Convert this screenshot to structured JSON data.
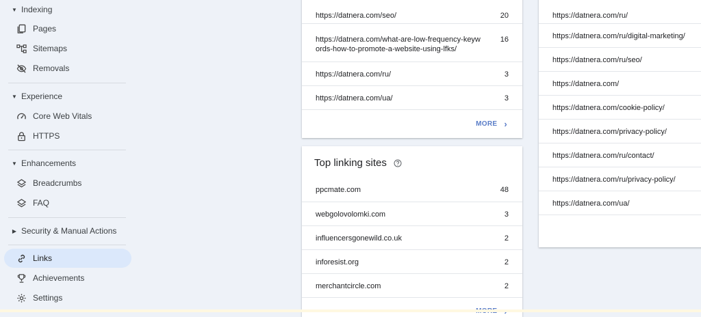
{
  "sidebar": {
    "sections": {
      "indexing": "Indexing",
      "experience": "Experience",
      "enhancements": "Enhancements",
      "security": "Security & Manual Actions"
    },
    "items": {
      "pages": "Pages",
      "sitemaps": "Sitemaps",
      "removals": "Removals",
      "core_web_vitals": "Core Web Vitals",
      "https": "HTTPS",
      "breadcrumbs": "Breadcrumbs",
      "faq": "FAQ",
      "links": "Links",
      "achievements": "Achievements",
      "settings": "Settings"
    },
    "active_item": "Links"
  },
  "top_linked_pages": {
    "rows": [
      {
        "url": "https://datnera.com/seo/",
        "count": "20"
      },
      {
        "url": "https://datnera.com/what-are-low-frequency-keyw",
        "url2": "ords-how-to-promote-a-website-using-lfks/",
        "count": "16"
      },
      {
        "url": "https://datnera.com/ru/",
        "count": "3"
      },
      {
        "url": "https://datnera.com/ua/",
        "count": "3"
      }
    ],
    "more_label": "MORE"
  },
  "top_linking_sites": {
    "title": "Top linking sites",
    "rows": [
      {
        "site": "ppcmate.com",
        "count": "48"
      },
      {
        "site": "webgolovolomki.com",
        "count": "3"
      },
      {
        "site": "influencersgonewild.co.uk",
        "count": "2"
      },
      {
        "site": "inforesist.org",
        "count": "2"
      },
      {
        "site": "merchantcircle.com",
        "count": "2"
      }
    ],
    "more_label": "MORE"
  },
  "internal_links": {
    "rows": [
      "https://datnera.com/ru/",
      "https://datnera.com/ru/digital-marketing/",
      "https://datnera.com/ru/seo/",
      "https://datnera.com/",
      "https://datnera.com/cookie-policy/",
      "https://datnera.com/privacy-policy/",
      "https://datnera.com/ru/contact/",
      "https://datnera.com/ru/privacy-policy/",
      "https://datnera.com/ua/"
    ]
  },
  "colors": {
    "background": "#eef2f8",
    "active_nav": "#dbe8fb",
    "link_accent": "#5a7dc8"
  }
}
